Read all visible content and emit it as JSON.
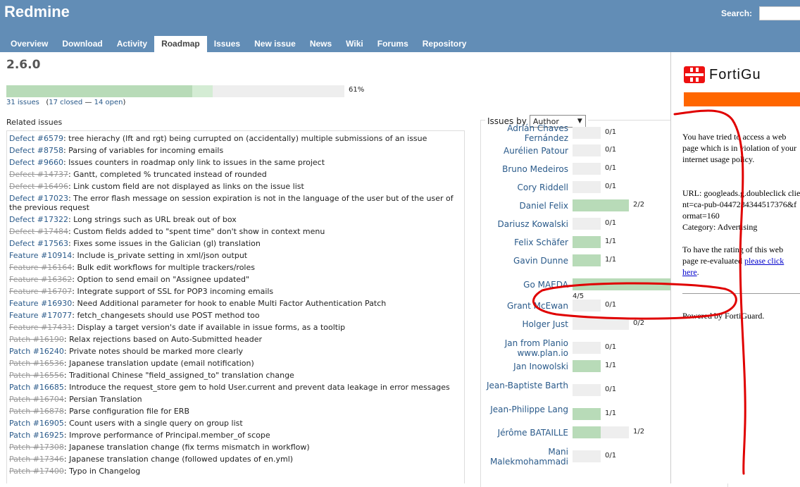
{
  "header": {
    "app_title": "Redmine",
    "search_label": "Search:",
    "tabs": [
      {
        "label": "Overview",
        "selected": false
      },
      {
        "label": "Download",
        "selected": false
      },
      {
        "label": "Activity",
        "selected": false
      },
      {
        "label": "Roadmap",
        "selected": true
      },
      {
        "label": "Issues",
        "selected": false
      },
      {
        "label": "New issue",
        "selected": false
      },
      {
        "label": "News",
        "selected": false
      },
      {
        "label": "Wiki",
        "selected": false
      },
      {
        "label": "Forums",
        "selected": false
      },
      {
        "label": "Repository",
        "selected": false
      }
    ]
  },
  "version": {
    "title": "2.6.0",
    "closed_fraction": 0.55,
    "done_fraction": 0.61,
    "percent_label": "61%",
    "issues_count": "31 issues",
    "closed_label": "17 closed",
    "open_label": "14 open"
  },
  "related": {
    "title": "Related issues",
    "issues": [
      {
        "id": "Defect #6579",
        "text": ": tree hierachy (lft and rgt) being currupted on (accidentally) multiple submissions of an issue",
        "closed": false
      },
      {
        "id": "Defect #8758",
        "text": ": Parsing of variables for incoming emails",
        "closed": false
      },
      {
        "id": "Defect #9660",
        "text": ": Issues counters in roadmap only link to issues in the same project",
        "closed": false
      },
      {
        "id": "Defect #14737",
        "text": ": Gantt, completed % truncated instead of rounded",
        "closed": true
      },
      {
        "id": "Defect #16496",
        "text": ": Link custom field are not displayed as links on the issue list",
        "closed": true
      },
      {
        "id": "Defect #17023",
        "text": ": The error flash message on session expiration is not in the language of the user but of the user of the previous request",
        "closed": false
      },
      {
        "id": "Defect #17322",
        "text": ": Long strings such as URL break out of box",
        "closed": false
      },
      {
        "id": "Defect #17484",
        "text": ": Custom fields added to \"spent time\" don't show in context menu",
        "closed": true
      },
      {
        "id": "Defect #17563",
        "text": ": Fixes some issues in the Galician (gl) translation",
        "closed": false
      },
      {
        "id": "Feature #10914",
        "text": ": Include is_private setting in xml/json output",
        "closed": false
      },
      {
        "id": "Feature #16164",
        "text": ": Bulk edit workflows for multiple trackers/roles",
        "closed": true
      },
      {
        "id": "Feature #16362",
        "text": ": Option to send email on \"Assignee updated\"",
        "closed": true
      },
      {
        "id": "Feature #16707",
        "text": ": Integrate support of SSL for POP3 incoming emails",
        "closed": true
      },
      {
        "id": "Feature #16930",
        "text": ": Need Additional parameter for hook to enable Multi Factor Authentication Patch",
        "closed": false
      },
      {
        "id": "Feature #17077",
        "text": ": fetch_changesets should use POST method too",
        "closed": false
      },
      {
        "id": "Feature #17431",
        "text": ": Display a target version's date if available in issue forms, as a tooltip",
        "closed": true
      },
      {
        "id": "Patch #16190",
        "text": ": Relax rejections based on Auto-Submitted header",
        "closed": true
      },
      {
        "id": "Patch #16240",
        "text": ": Private notes should be marked more clearly",
        "closed": false
      },
      {
        "id": "Patch #16536",
        "text": ": Japanese translation update (email notification)",
        "closed": true
      },
      {
        "id": "Patch #16556",
        "text": ": Traditional Chinese \"field_assigned_to\" translation change",
        "closed": true
      },
      {
        "id": "Patch #16685",
        "text": ": Introduce the request_store gem to hold User.current and prevent data leakage in error messages",
        "closed": false
      },
      {
        "id": "Patch #16704",
        "text": ": Persian Translation",
        "closed": true
      },
      {
        "id": "Patch #16878",
        "text": ": Parse configuration file for ERB",
        "closed": true
      },
      {
        "id": "Patch #16905",
        "text": ": Count users with a single query on group list",
        "closed": false
      },
      {
        "id": "Patch #16925",
        "text": ": Improve performance of Principal.member_of scope",
        "closed": false
      },
      {
        "id": "Patch #17308",
        "text": ": Japanese translation change (fix terms mismatch in workflow)",
        "closed": true
      },
      {
        "id": "Patch #17346",
        "text": ": Japanese translation change (followed updates of en.yml)",
        "closed": true
      },
      {
        "id": "Patch #17400",
        "text": ": Typo in Changelog",
        "closed": true
      }
    ]
  },
  "issues_by": {
    "label": "Issues by",
    "selected": "Author",
    "authors": [
      {
        "name": "Adrián Chaves Fernández",
        "done": 0,
        "total": 1,
        "count": "0/1"
      },
      {
        "name": "Aurélien Patour",
        "done": 0,
        "total": 1,
        "count": "0/1"
      },
      {
        "name": "Bruno Medeiros",
        "done": 0,
        "total": 1,
        "count": "0/1"
      },
      {
        "name": "Cory Riddell",
        "done": 0,
        "total": 1,
        "count": "0/1"
      },
      {
        "name": "Daniel Felix",
        "done": 2,
        "total": 2,
        "count": "2/2"
      },
      {
        "name": "Dariusz Kowalski",
        "done": 0,
        "total": 1,
        "count": "0/1"
      },
      {
        "name": "Felix Schäfer",
        "done": 1,
        "total": 1,
        "count": "1/1"
      },
      {
        "name": "Gavin Dunne",
        "done": 1,
        "total": 1,
        "count": "1/1"
      },
      {
        "name": "Go MAEDA",
        "done": 4,
        "total": 5,
        "count": "4/5"
      },
      {
        "name": "Grant McEwan",
        "done": 0,
        "total": 1,
        "count": "0/1"
      },
      {
        "name": "Holger Just",
        "done": 0,
        "total": 2,
        "count": "0/2"
      },
      {
        "name": "Jan from Planio www.plan.io",
        "done": 0,
        "total": 1,
        "count": "0/1"
      },
      {
        "name": "Jan Inowolski",
        "done": 1,
        "total": 1,
        "count": "1/1"
      },
      {
        "name": "Jean-Baptiste Barth",
        "done": 0,
        "total": 1,
        "count": "0/1"
      },
      {
        "name": "Jean-Philippe Lang",
        "done": 1,
        "total": 1,
        "count": "1/1"
      },
      {
        "name": "Jérôme BATAILLE",
        "done": 1,
        "total": 2,
        "count": "1/2"
      },
      {
        "name": "Mani Malekmohammadi",
        "done": 0,
        "total": 1,
        "count": "0/1"
      }
    ]
  },
  "sidebar": {
    "logo_text": "FortiGu",
    "message": "You have tried to access a web page which is in violation of your internet usage policy.",
    "url_line": "URL: googleads.g.doubleclick client=ca-pub-0447284344517376&format=160",
    "category_line": "Category: Advertising",
    "rating_text": "To have the rating of this web page re-evaluated",
    "rating_link": "please click here",
    "rating_end": ".",
    "powered": "Powered by FortiGuard."
  },
  "colors": {
    "header": "#628db6",
    "progress_closed": "#b8dbb8",
    "progress_done": "#d4ecd4",
    "forti_orange": "#ff6600",
    "annotation_red": "#e00000"
  }
}
